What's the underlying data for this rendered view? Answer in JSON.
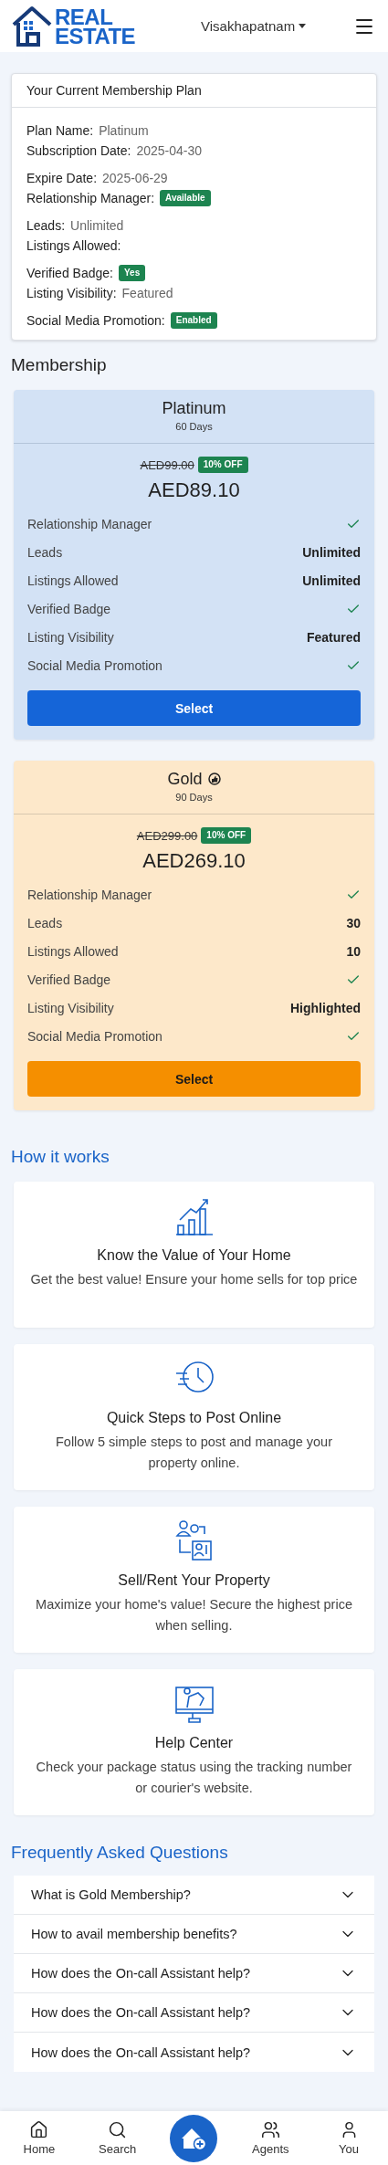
{
  "header": {
    "logo": [
      "REAL",
      "ESTATE"
    ],
    "location": "Visakhapatnam"
  },
  "current_plan": {
    "title": "Your Current Membership Plan",
    "groups": [
      [
        {
          "label": "Plan Name:",
          "kind": "text",
          "value": "Platinum"
        },
        {
          "label": "Subscription Date:",
          "kind": "text",
          "value": "2025-04-30"
        }
      ],
      [
        {
          "label": "Expire Date:",
          "kind": "text",
          "value": "2025-06-29"
        },
        {
          "label": "Relationship Manager:",
          "kind": "badge",
          "value": "Available"
        }
      ],
      [
        {
          "label": "Leads:",
          "kind": "text",
          "value": "Unlimited"
        },
        {
          "label": "Listings Allowed:"
        }
      ],
      [
        {
          "label": "Verified Badge:",
          "kind": "badge",
          "value": "Yes"
        },
        {
          "label": "Listing Visibility:",
          "kind": "text",
          "value": "Featured"
        }
      ],
      [
        {
          "label": "Social Media Promotion:",
          "kind": "badge",
          "value": "Enabled"
        }
      ]
    ]
  },
  "membership": {
    "title": "Membership",
    "plans": [
      {
        "kind": "platinum",
        "name": "Platinum",
        "duration": "60 Days",
        "recommended": false,
        "old_price": "AED99.00",
        "discount": "10% OFF",
        "price": "AED89.10",
        "button": "Select",
        "features": [
          {
            "label": "Relationship Manager",
            "kind": "check"
          },
          {
            "label": "Leads",
            "kind": "text",
            "value": "Unlimited"
          },
          {
            "label": "Listings Allowed",
            "kind": "text",
            "value": "Unlimited"
          },
          {
            "label": "Verified Badge",
            "kind": "check"
          },
          {
            "label": "Listing Visibility",
            "kind": "text",
            "value": "Featured"
          },
          {
            "label": "Social Media Promotion",
            "kind": "check"
          }
        ]
      },
      {
        "kind": "gold",
        "name": "Gold",
        "duration": "90 Days",
        "recommended": true,
        "old_price": "AED299.00",
        "discount": "10% OFF",
        "price": "AED269.10",
        "button": "Select",
        "features": [
          {
            "label": "Relationship Manager",
            "kind": "check"
          },
          {
            "label": "Leads",
            "kind": "text",
            "value": "30"
          },
          {
            "label": "Listings Allowed",
            "kind": "text",
            "value": "10"
          },
          {
            "label": "Verified Badge",
            "kind": "check"
          },
          {
            "label": "Listing Visibility",
            "kind": "text",
            "value": "Highlighted"
          },
          {
            "label": "Social Media Promotion",
            "kind": "check"
          }
        ]
      }
    ]
  },
  "how_it_works": {
    "title": "How it works",
    "steps": [
      {
        "kind": "chart",
        "title": "Know the Value of Your Home",
        "text": "Get the best value! Ensure your home sells for top price"
      },
      {
        "kind": "clock",
        "title": "Quick Steps to Post Online",
        "text": "Follow 5 simple steps to post and manage your property online."
      },
      {
        "kind": "exchange",
        "title": "Sell/Rent Your Property",
        "text": "Maximize your home's value! Secure the highest price when selling."
      },
      {
        "kind": "monitor",
        "title": "Help Center",
        "text": "Check your package status using the tracking number or courier's website."
      }
    ]
  },
  "faq": {
    "title": "Frequently Asked Questions",
    "items": [
      {
        "question": "What is Gold Membership?",
        "expanded": false
      },
      {
        "question": "How to avail membership benefits?",
        "expanded": false
      },
      {
        "question": "How does the On-call Assistant help?",
        "expanded": false
      },
      {
        "question": "How does the On-call Assistant help?",
        "expanded": false
      },
      {
        "question": "How does the On-call Assistant help?",
        "expanded": false
      }
    ]
  },
  "bottom_nav": [
    {
      "kind": "home",
      "label": "Home"
    },
    {
      "kind": "search",
      "label": "Search"
    },
    {
      "kind": "post"
    },
    {
      "kind": "agents",
      "label": "Agents"
    },
    {
      "kind": "user",
      "label": "You"
    }
  ]
}
